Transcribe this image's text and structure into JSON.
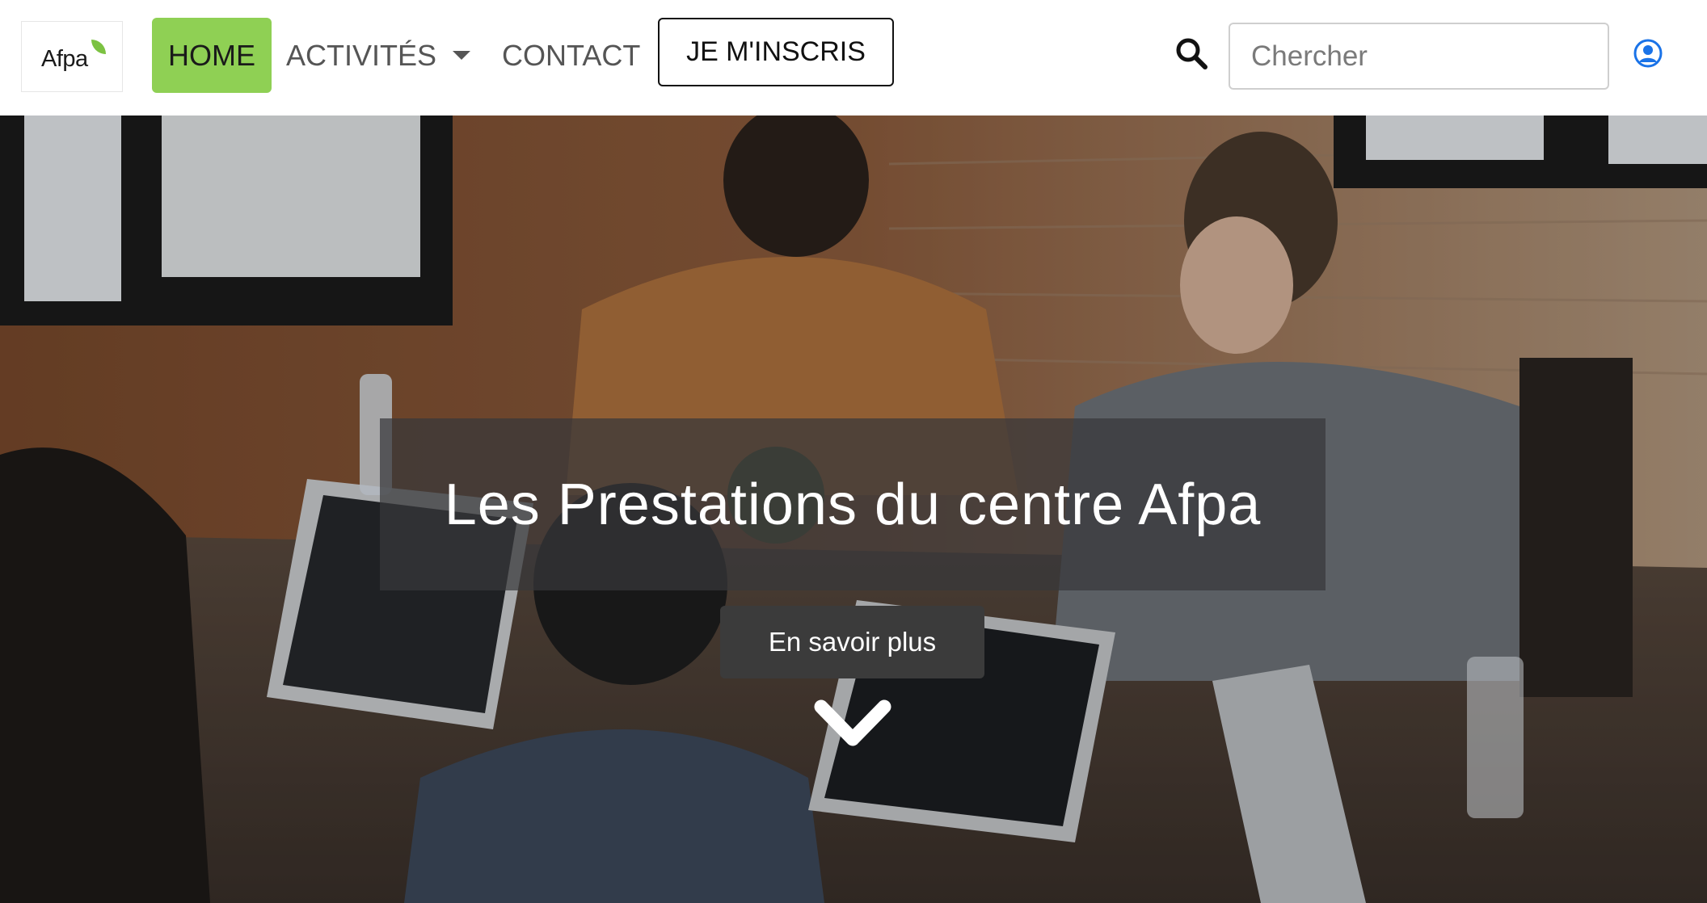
{
  "brand": {
    "logo_text": "Afpa",
    "accent_color": "#8fd054",
    "leaf_color": "#7cc242"
  },
  "nav": {
    "home": "HOME",
    "activites": "ACTIVITÉS",
    "contact": "CONTACT",
    "signup": "JE M'INSCRIS"
  },
  "search": {
    "placeholder": "Chercher",
    "value": "",
    "icon": "search-icon"
  },
  "user": {
    "icon": "user-circle-icon",
    "color": "#1a73e8"
  },
  "hero": {
    "title": "Les Prestations du centre Afpa",
    "cta_label": "En savoir plus",
    "scroll_icon": "chevron-down-icon"
  }
}
